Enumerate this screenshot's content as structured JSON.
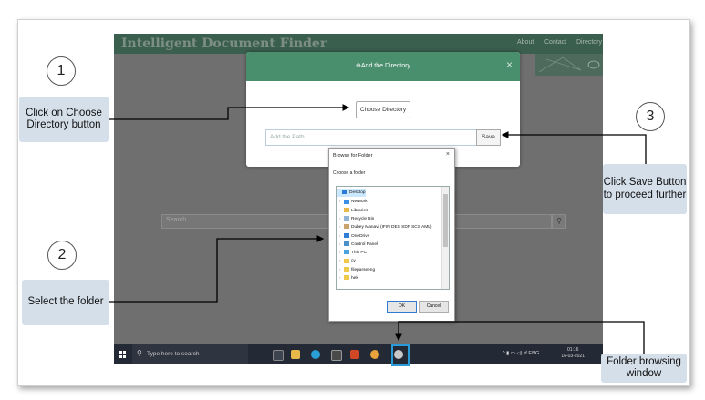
{
  "app": {
    "title": "Intelligent Document Finder",
    "nav": [
      "About",
      "Contact",
      "Directory"
    ],
    "search_placeholder": "Search"
  },
  "modal": {
    "title": "Add the Directory",
    "close": "×",
    "choose_button": "Choose Directory",
    "path_placeholder": "Add the Path",
    "save_button": "Save"
  },
  "browse_dialog": {
    "title": "Browse for Folder",
    "close": "×",
    "instruction": "Choose a folder",
    "items": [
      {
        "label": "Desktop",
        "icon": "desktop-icon",
        "color": "#2b7bd6",
        "indent": 0,
        "selected": true
      },
      {
        "label": "Network",
        "icon": "network-icon",
        "color": "#3a8ee6",
        "indent": 1
      },
      {
        "label": "Libraries",
        "icon": "library-icon",
        "color": "#e8b84a",
        "indent": 1
      },
      {
        "label": "Recycle Bin",
        "icon": "recycle-bin-icon",
        "color": "#8fb3d9",
        "indent": 1
      },
      {
        "label": "Dubey Manavi (IFIN DES SDF SCS AML)",
        "icon": "user-icon",
        "color": "#c9a36b",
        "indent": 1
      },
      {
        "label": "OneDrive",
        "icon": "onedrive-icon",
        "color": "#2f7ed8",
        "indent": 1
      },
      {
        "label": "Control Panel",
        "icon": "control-panel-icon",
        "color": "#4a90c8",
        "indent": 1
      },
      {
        "label": "This PC",
        "icon": "computer-icon",
        "color": "#4aa3df",
        "indent": 1
      },
      {
        "label": "cv",
        "icon": "folder-icon",
        "color": "#f0c94a",
        "indent": 1
      },
      {
        "label": "fileparseeng",
        "icon": "folder-icon",
        "color": "#f0c94a",
        "indent": 1
      },
      {
        "label": "hek",
        "icon": "folder-icon",
        "color": "#f0c94a",
        "indent": 1
      }
    ],
    "ok_button": "OK",
    "cancel_button": "Cancel"
  },
  "taskbar": {
    "search_placeholder": "Type here to search",
    "tray_lang": "ENG",
    "time": "01:16",
    "date": "16-03-2021"
  },
  "annotations": [
    {
      "number": "1",
      "text": "Click on Choose Directory button"
    },
    {
      "number": "2",
      "text": "Select the folder"
    },
    {
      "number": "3",
      "text": "Click Save Button to proceed further"
    }
  ],
  "folder_callout": "Folder browsing window"
}
